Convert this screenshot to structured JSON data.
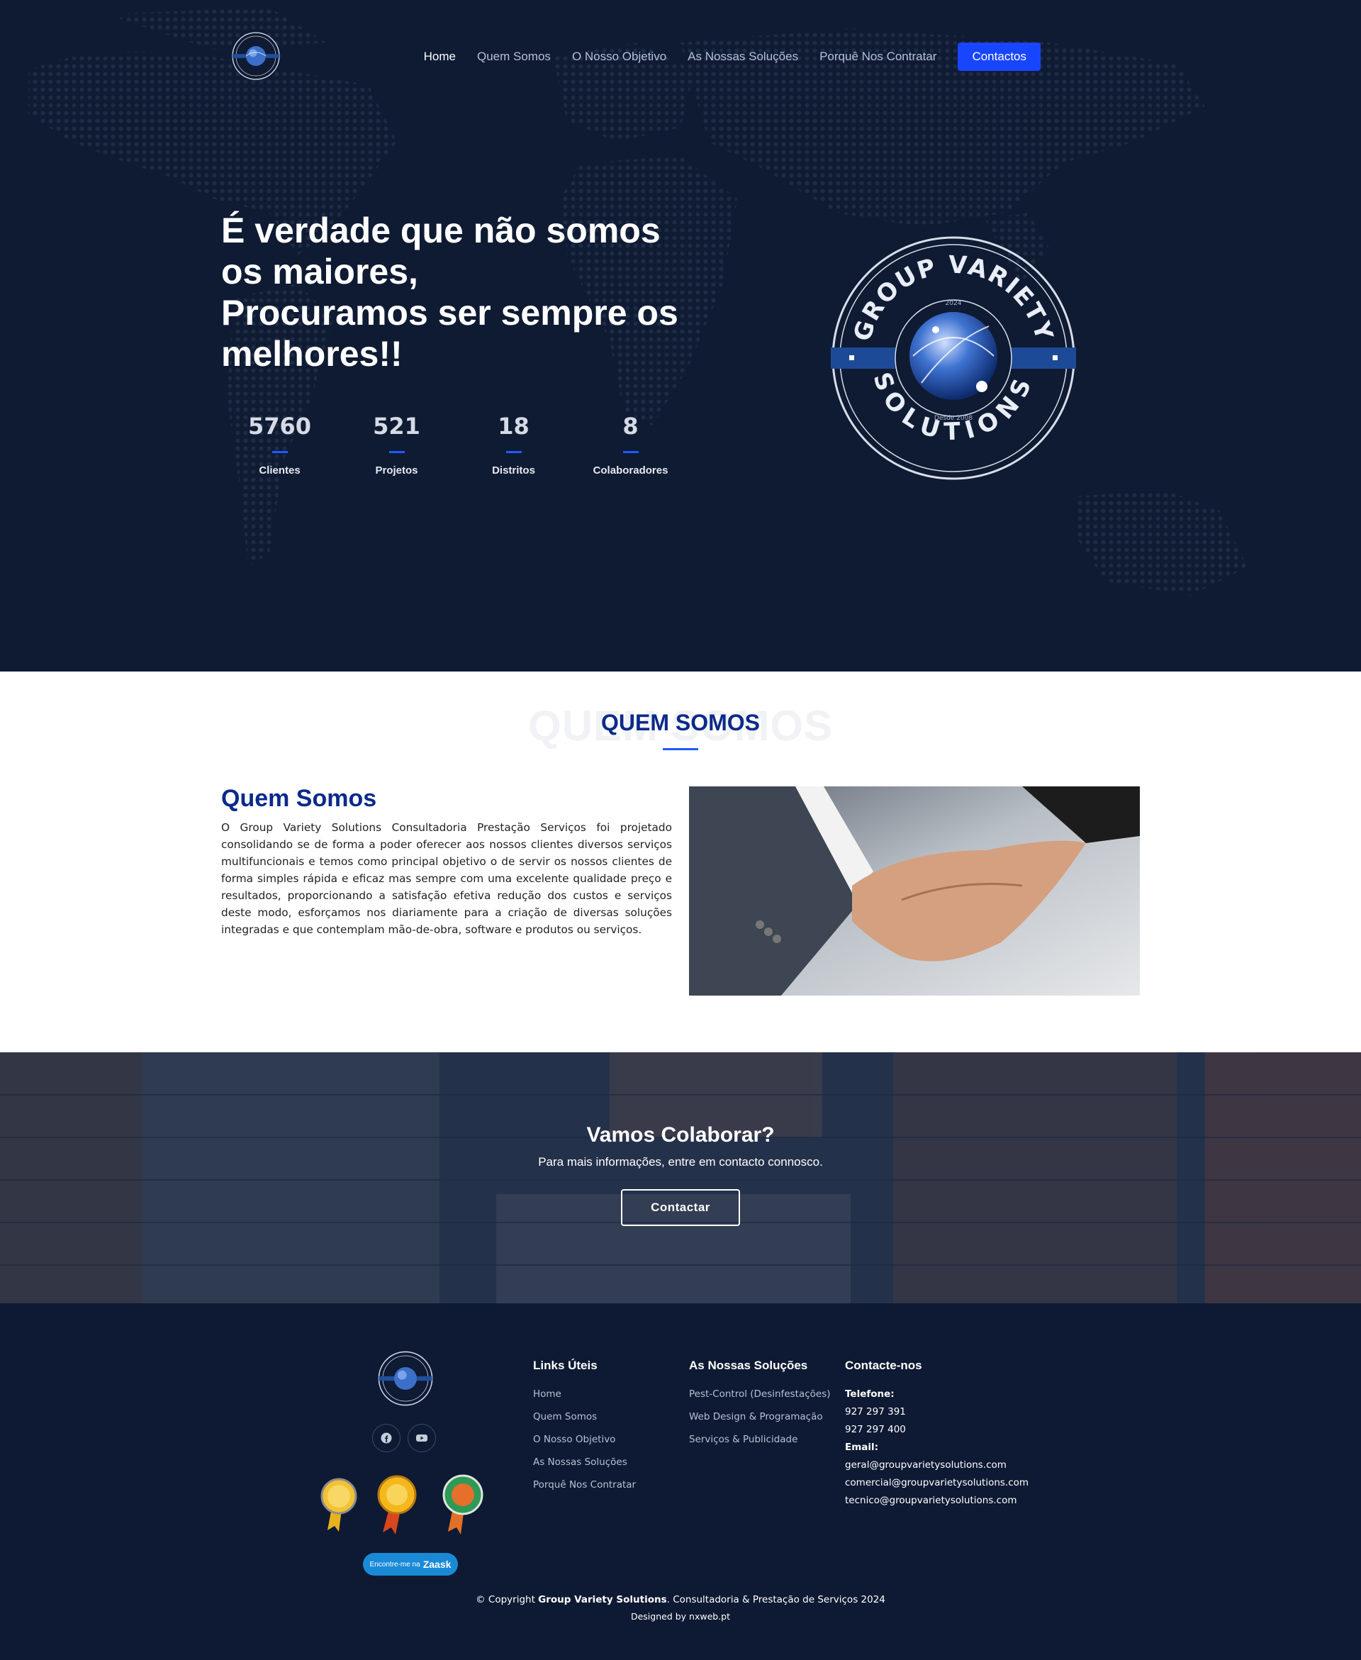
{
  "nav": {
    "items": [
      {
        "label": "Home",
        "active": true
      },
      {
        "label": "Quem Somos"
      },
      {
        "label": "O Nosso Objetivo"
      },
      {
        "label": "As Nossas Soluções"
      },
      {
        "label": "Porquê Nos Contratar"
      }
    ],
    "cta": "Contactos"
  },
  "logo": {
    "top_text": "GROUP VARIETY",
    "bottom_text": "SOLUTIONS",
    "year": "2024",
    "since": "Desde 2008"
  },
  "hero": {
    "title_lines": [
      "É verdade que não somos",
      "os maiores,",
      "Procuramos ser sempre os",
      "melhores!!"
    ],
    "stats": [
      {
        "value": "5760",
        "label": "Clientes"
      },
      {
        "value": "521",
        "label": "Projetos"
      },
      {
        "value": "18",
        "label": "Distritos"
      },
      {
        "value": "8",
        "label": "Colaboradores"
      }
    ]
  },
  "about": {
    "ghost": "QUEM SOMOS",
    "section_title": "QUEM SOMOS",
    "heading": "Quem Somos",
    "text": "O Group Variety Solutions Consultadoria Prestação Serviços foi projetado consolidando se de forma a poder oferecer aos nossos clientes diversos serviços multifuncionais e temos como principal objetivo o de servir os nossos clientes de forma simples rápida e eficaz mas sempre com uma excelente qualidade preço e resultados, proporcionando a satisfação efetiva redução dos custos e serviços deste modo, esforçamos nos diariamente para a criação de diversas soluções integradas e que contemplam mão-de-obra, software e produtos ou serviços."
  },
  "cta": {
    "title": "Vamos Colaborar?",
    "subtitle": "Para mais informações, entre em contacto connosco.",
    "button": "Contactar"
  },
  "footer": {
    "zaask": {
      "prefix": "Encontre-me na",
      "brand": "Zaask"
    },
    "links": {
      "title": "Links Úteis",
      "items": [
        "Home",
        "Quem Somos",
        "O Nosso Objetivo",
        "As Nossas Soluções",
        "Porquê Nos Contratar"
      ]
    },
    "solutions": {
      "title": "As Nossas Soluções",
      "items": [
        "Pest-Control (Desinfestações)",
        "Web Design & Programação",
        "Serviços & Publicidade"
      ]
    },
    "contact": {
      "title": "Contacte-nos",
      "phone_label": "Telefone:",
      "phones": [
        "927 297 391",
        "927 297 400"
      ],
      "email_label": "Email:",
      "emails": [
        "geral@groupvarietysolutions.com",
        "comercial@groupvarietysolutions.com",
        "tecnico@groupvarietysolutions.com"
      ]
    },
    "copyright_prefix": "© Copyright ",
    "copyright_brand": "Group Variety Solutions",
    "copyright_suffix": ". Consultadoria & Prestação de Serviços 2024",
    "designed": "Designed by nxweb.pt"
  },
  "colors": {
    "navy": "#0f1b33",
    "accent": "#1846ff",
    "heading_blue": "#0b2a8a"
  }
}
